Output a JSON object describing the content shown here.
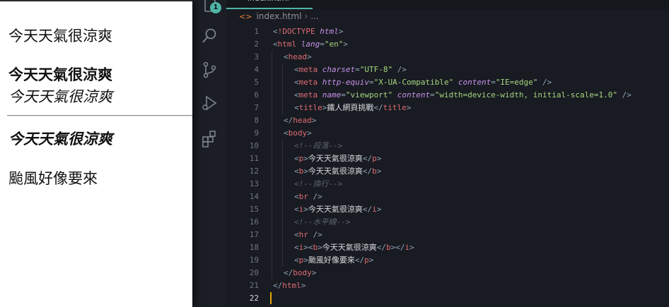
{
  "preview": {
    "lines": [
      {
        "text": "今天天氣很涼爽",
        "style": "normal"
      },
      {
        "text": "今天天氣很涼爽",
        "style": "bold"
      },
      {
        "text": "今天天氣很涼爽",
        "style": "italic"
      },
      {
        "text": "今天天氣很涼爽",
        "style": "bold-italic"
      },
      {
        "text": "颱風好像要來",
        "style": "normal"
      }
    ]
  },
  "activity_bar": {
    "badge": "1",
    "icons": [
      "files-icon",
      "search-icon",
      "source-control-icon",
      "run-debug-icon",
      "extensions-icon"
    ]
  },
  "editor": {
    "breadcrumb": {
      "file": "index.html",
      "more": "..."
    },
    "active_line": 22,
    "lines": [
      "<!DOCTYPE html>",
      "<html lang=\"en\">",
      "<head>",
      "<meta charset=\"UTF-8\" />",
      "<meta http-equiv=\"X-UA-Compatible\" content=\"IE=edge\" />",
      "<meta name=\"viewport\" content=\"width=device-width, initial-scale=1.0\" />",
      "<title>鐵人網頁挑戰</title>",
      "</head>",
      "<body>",
      "<!--段落-->",
      "<p>今天天氣很涼爽</p>",
      "<b>今天天氣很涼爽</b>",
      "<!--換行-->",
      "<br />",
      "<i>今天天氣很涼爽</i>",
      "<!--水平線-->",
      "<hr />",
      "<i><b>今天天氣很涼爽</b></i>",
      "<p>颱風好像要來</p>",
      "</body>",
      "</html>",
      ""
    ],
    "indent": [
      0,
      0,
      1,
      2,
      2,
      2,
      2,
      1,
      1,
      2,
      2,
      2,
      2,
      2,
      2,
      2,
      2,
      2,
      2,
      1,
      0,
      0
    ]
  },
  "colors": {
    "accent": "#4fb5a7",
    "tag": "#e06c75",
    "attribute": "#c792ea",
    "string": "#a5d680",
    "comment": "#5c6370",
    "cursor": "#e5a50a"
  }
}
